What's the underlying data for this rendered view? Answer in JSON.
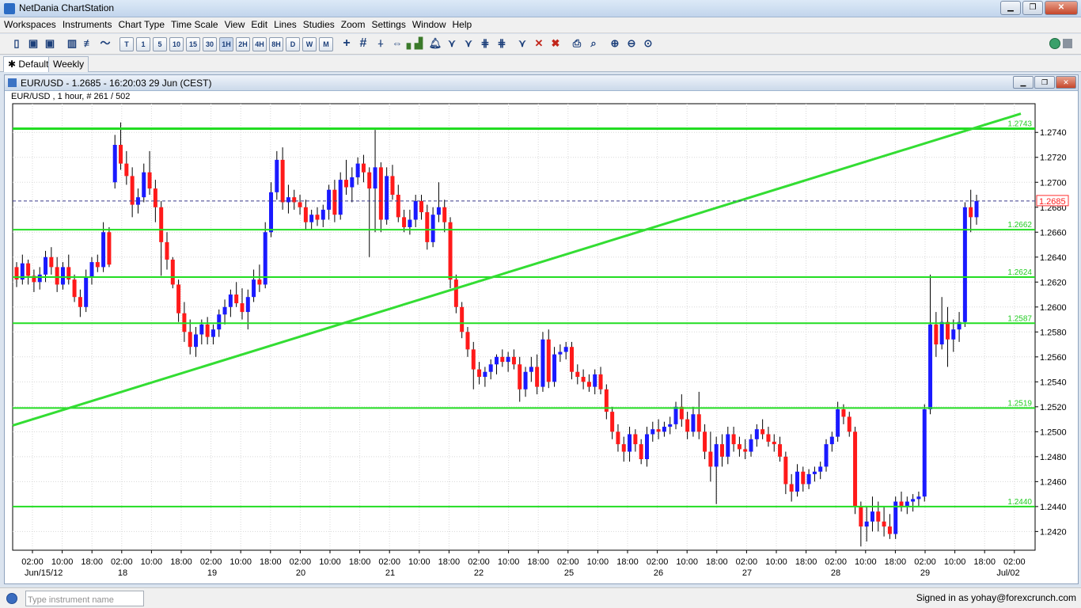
{
  "window": {
    "title": "NetDania ChartStation",
    "controls": [
      "minimize",
      "restore",
      "close"
    ]
  },
  "menu": [
    "Workspaces",
    "Instruments",
    "Chart Type",
    "Time Scale",
    "View",
    "Edit",
    "Lines",
    "Studies",
    "Zoom",
    "Settings",
    "Window",
    "Help"
  ],
  "toolbar": {
    "timeframes": [
      "T",
      "1",
      "5",
      "10",
      "15",
      "30",
      "1H",
      "2H",
      "4H",
      "8H",
      "D",
      "W",
      "M"
    ],
    "selected_timeframe": "1H"
  },
  "tabs": [
    {
      "label": "Default",
      "active": true
    },
    {
      "label": "Weekly",
      "active": false
    }
  ],
  "chart_window": {
    "title": "EUR/USD - 1.2685 - 16:20:03  29 Jun (CEST)",
    "info": "EUR/USD , 1 hour, # 261 / 502"
  },
  "chart_data": {
    "type": "candlestick",
    "symbol": "EUR/USD",
    "interval": "1 hour",
    "last_price": "1.2685",
    "ylim": [
      1.2405,
      1.2763
    ],
    "y_ticks": [
      "1.2420",
      "1.2440",
      "1.2460",
      "1.2480",
      "1.2500",
      "1.2520",
      "1.2540",
      "1.2560",
      "1.2580",
      "1.2600",
      "1.2620",
      "1.2640",
      "1.2660",
      "1.2680",
      "1.2700",
      "1.2720",
      "1.2740"
    ],
    "x_time_labels": [
      "02:00",
      "10:00",
      "18:00",
      "02:00",
      "10:00",
      "18:00",
      "02:00",
      "10:00",
      "18:00",
      "02:00",
      "10:00",
      "18:00",
      "02:00",
      "10:00",
      "18:00",
      "02:00",
      "10:00",
      "18:00",
      "02:00",
      "10:00",
      "18:00",
      "02:00",
      "10:00",
      "18:00",
      "02:00",
      "10:00",
      "18:00",
      "02:00",
      "10:00",
      "18:00",
      "02:00",
      "10:00",
      "18:00",
      "02:00"
    ],
    "x_date_labels": [
      "Jun/15/12",
      "18",
      "19",
      "20",
      "21",
      "22",
      "25",
      "26",
      "27",
      "28",
      "29",
      "Jul/02"
    ],
    "horizontal_lines": [
      1.2743,
      1.2662,
      1.2624,
      1.2587,
      1.2519,
      1.244
    ],
    "horizontal_line_labels": [
      "1.2743",
      "1.2662",
      "1.2624",
      "1.2587",
      "1.2519",
      "1.2440"
    ],
    "trendline": {
      "start": 1.2505,
      "end": 1.2755
    },
    "current_price_label": "1.2685",
    "candles": [
      {
        "o": 1.2632,
        "h": 1.2636,
        "l": 1.2616,
        "c": 1.2622
      },
      {
        "o": 1.2622,
        "h": 1.2642,
        "l": 1.2618,
        "c": 1.2635
      },
      {
        "o": 1.2635,
        "h": 1.2638,
        "l": 1.2618,
        "c": 1.2625
      },
      {
        "o": 1.2625,
        "h": 1.263,
        "l": 1.2612,
        "c": 1.262
      },
      {
        "o": 1.262,
        "h": 1.2632,
        "l": 1.2614,
        "c": 1.2626
      },
      {
        "o": 1.2626,
        "h": 1.2645,
        "l": 1.262,
        "c": 1.264
      },
      {
        "o": 1.264,
        "h": 1.2648,
        "l": 1.2626,
        "c": 1.2632
      },
      {
        "o": 1.2632,
        "h": 1.264,
        "l": 1.2612,
        "c": 1.2618
      },
      {
        "o": 1.2618,
        "h": 1.2636,
        "l": 1.2614,
        "c": 1.2632
      },
      {
        "o": 1.2632,
        "h": 1.2642,
        "l": 1.2618,
        "c": 1.2622
      },
      {
        "o": 1.2622,
        "h": 1.2626,
        "l": 1.2604,
        "c": 1.2608
      },
      {
        "o": 1.2608,
        "h": 1.2614,
        "l": 1.2592,
        "c": 1.26
      },
      {
        "o": 1.26,
        "h": 1.263,
        "l": 1.2596,
        "c": 1.2624
      },
      {
        "o": 1.2624,
        "h": 1.264,
        "l": 1.2618,
        "c": 1.2636
      },
      {
        "o": 1.2636,
        "h": 1.2642,
        "l": 1.2628,
        "c": 1.2632
      },
      {
        "o": 1.2632,
        "h": 1.2668,
        "l": 1.2628,
        "c": 1.266
      },
      {
        "o": 1.266,
        "h": 1.2664,
        "l": 1.2632,
        "c": 1.2634
      },
      {
        "o": 1.27,
        "h": 1.2738,
        "l": 1.2695,
        "c": 1.273
      },
      {
        "o": 1.273,
        "h": 1.2748,
        "l": 1.271,
        "c": 1.2715
      },
      {
        "o": 1.2715,
        "h": 1.2725,
        "l": 1.2698,
        "c": 1.2705
      },
      {
        "o": 1.2705,
        "h": 1.2712,
        "l": 1.2672,
        "c": 1.2682
      },
      {
        "o": 1.2682,
        "h": 1.2695,
        "l": 1.2675,
        "c": 1.2688
      },
      {
        "o": 1.2688,
        "h": 1.2715,
        "l": 1.2684,
        "c": 1.2708
      },
      {
        "o": 1.2708,
        "h": 1.2725,
        "l": 1.269,
        "c": 1.2695
      },
      {
        "o": 1.2695,
        "h": 1.2702,
        "l": 1.2668,
        "c": 1.268
      },
      {
        "o": 1.268,
        "h": 1.2685,
        "l": 1.2625,
        "c": 1.2652
      },
      {
        "o": 1.2652,
        "h": 1.266,
        "l": 1.263,
        "c": 1.2638
      },
      {
        "o": 1.2638,
        "h": 1.264,
        "l": 1.2615,
        "c": 1.2618
      },
      {
        "o": 1.2618,
        "h": 1.2622,
        "l": 1.2588,
        "c": 1.2595
      },
      {
        "o": 1.2595,
        "h": 1.2604,
        "l": 1.2572,
        "c": 1.258
      },
      {
        "o": 1.258,
        "h": 1.259,
        "l": 1.2562,
        "c": 1.2568
      },
      {
        "o": 1.2568,
        "h": 1.2584,
        "l": 1.256,
        "c": 1.2578
      },
      {
        "o": 1.2578,
        "h": 1.259,
        "l": 1.257,
        "c": 1.2586
      },
      {
        "o": 1.2586,
        "h": 1.2592,
        "l": 1.257,
        "c": 1.2576
      },
      {
        "o": 1.2576,
        "h": 1.2586,
        "l": 1.257,
        "c": 1.2582
      },
      {
        "o": 1.2582,
        "h": 1.2598,
        "l": 1.2576,
        "c": 1.2594
      },
      {
        "o": 1.2594,
        "h": 1.2606,
        "l": 1.2586,
        "c": 1.26
      },
      {
        "o": 1.26,
        "h": 1.2614,
        "l": 1.2592,
        "c": 1.261
      },
      {
        "o": 1.261,
        "h": 1.262,
        "l": 1.26,
        "c": 1.2603
      },
      {
        "o": 1.2603,
        "h": 1.2615,
        "l": 1.259,
        "c": 1.2596
      },
      {
        "o": 1.2596,
        "h": 1.2614,
        "l": 1.2582,
        "c": 1.2608
      },
      {
        "o": 1.2608,
        "h": 1.263,
        "l": 1.2604,
        "c": 1.2622
      },
      {
        "o": 1.2622,
        "h": 1.2634,
        "l": 1.2612,
        "c": 1.2618
      },
      {
        "o": 1.2618,
        "h": 1.2668,
        "l": 1.2615,
        "c": 1.266
      },
      {
        "o": 1.266,
        "h": 1.27,
        "l": 1.2656,
        "c": 1.2692
      },
      {
        "o": 1.2692,
        "h": 1.2725,
        "l": 1.2686,
        "c": 1.2718
      },
      {
        "o": 1.2718,
        "h": 1.2728,
        "l": 1.2678,
        "c": 1.2684
      },
      {
        "o": 1.2684,
        "h": 1.2698,
        "l": 1.2675,
        "c": 1.2688
      },
      {
        "o": 1.2688,
        "h": 1.2694,
        "l": 1.2678,
        "c": 1.2684
      },
      {
        "o": 1.2684,
        "h": 1.269,
        "l": 1.2674,
        "c": 1.268
      },
      {
        "o": 1.268,
        "h": 1.2686,
        "l": 1.2662,
        "c": 1.2668
      },
      {
        "o": 1.2668,
        "h": 1.2678,
        "l": 1.2662,
        "c": 1.2674
      },
      {
        "o": 1.2674,
        "h": 1.268,
        "l": 1.2665,
        "c": 1.267
      },
      {
        "o": 1.267,
        "h": 1.2682,
        "l": 1.2664,
        "c": 1.2678
      },
      {
        "o": 1.2678,
        "h": 1.2698,
        "l": 1.267,
        "c": 1.2694
      },
      {
        "o": 1.2694,
        "h": 1.2702,
        "l": 1.2668,
        "c": 1.2674
      },
      {
        "o": 1.2674,
        "h": 1.2708,
        "l": 1.267,
        "c": 1.2702
      },
      {
        "o": 1.2702,
        "h": 1.2718,
        "l": 1.269,
        "c": 1.2696
      },
      {
        "o": 1.2696,
        "h": 1.2712,
        "l": 1.2684,
        "c": 1.2704
      },
      {
        "o": 1.2704,
        "h": 1.272,
        "l": 1.2698,
        "c": 1.2715
      },
      {
        "o": 1.2715,
        "h": 1.2722,
        "l": 1.27,
        "c": 1.2708
      },
      {
        "o": 1.2708,
        "h": 1.2712,
        "l": 1.264,
        "c": 1.2695
      },
      {
        "o": 1.2695,
        "h": 1.2742,
        "l": 1.266,
        "c": 1.2712
      },
      {
        "o": 1.2712,
        "h": 1.2716,
        "l": 1.266,
        "c": 1.267
      },
      {
        "o": 1.267,
        "h": 1.2712,
        "l": 1.2666,
        "c": 1.2705
      },
      {
        "o": 1.2705,
        "h": 1.2714,
        "l": 1.2686,
        "c": 1.269
      },
      {
        "o": 1.269,
        "h": 1.2698,
        "l": 1.2668,
        "c": 1.2672
      },
      {
        "o": 1.2672,
        "h": 1.2678,
        "l": 1.266,
        "c": 1.2664
      },
      {
        "o": 1.2664,
        "h": 1.2678,
        "l": 1.2658,
        "c": 1.267
      },
      {
        "o": 1.267,
        "h": 1.269,
        "l": 1.2664,
        "c": 1.2685
      },
      {
        "o": 1.2685,
        "h": 1.269,
        "l": 1.267,
        "c": 1.2676
      },
      {
        "o": 1.2676,
        "h": 1.2682,
        "l": 1.2646,
        "c": 1.2652
      },
      {
        "o": 1.2652,
        "h": 1.268,
        "l": 1.2648,
        "c": 1.2674
      },
      {
        "o": 1.2674,
        "h": 1.27,
        "l": 1.2668,
        "c": 1.268
      },
      {
        "o": 1.268,
        "h": 1.2686,
        "l": 1.266,
        "c": 1.2668
      },
      {
        "o": 1.2668,
        "h": 1.2672,
        "l": 1.2615,
        "c": 1.2622
      },
      {
        "o": 1.2622,
        "h": 1.2626,
        "l": 1.2595,
        "c": 1.26
      },
      {
        "o": 1.26,
        "h": 1.2604,
        "l": 1.2575,
        "c": 1.258
      },
      {
        "o": 1.258,
        "h": 1.2584,
        "l": 1.256,
        "c": 1.2566
      },
      {
        "o": 1.2566,
        "h": 1.2572,
        "l": 1.2534,
        "c": 1.255
      },
      {
        "o": 1.255,
        "h": 1.2556,
        "l": 1.2538,
        "c": 1.2544
      },
      {
        "o": 1.2544,
        "h": 1.2552,
        "l": 1.2536,
        "c": 1.2548
      },
      {
        "o": 1.2548,
        "h": 1.2558,
        "l": 1.2542,
        "c": 1.2554
      },
      {
        "o": 1.2554,
        "h": 1.2562,
        "l": 1.2546,
        "c": 1.256
      },
      {
        "o": 1.256,
        "h": 1.2566,
        "l": 1.2552,
        "c": 1.2556
      },
      {
        "o": 1.2556,
        "h": 1.2564,
        "l": 1.2548,
        "c": 1.256
      },
      {
        "o": 1.256,
        "h": 1.2566,
        "l": 1.255,
        "c": 1.2554
      },
      {
        "o": 1.2554,
        "h": 1.256,
        "l": 1.2524,
        "c": 1.2534
      },
      {
        "o": 1.2534,
        "h": 1.2552,
        "l": 1.2528,
        "c": 1.2548
      },
      {
        "o": 1.2548,
        "h": 1.256,
        "l": 1.254,
        "c": 1.2552
      },
      {
        "o": 1.2552,
        "h": 1.2562,
        "l": 1.253,
        "c": 1.2536
      },
      {
        "o": 1.2536,
        "h": 1.258,
        "l": 1.2532,
        "c": 1.2574
      },
      {
        "o": 1.2574,
        "h": 1.2582,
        "l": 1.2535,
        "c": 1.254
      },
      {
        "o": 1.254,
        "h": 1.2568,
        "l": 1.2536,
        "c": 1.2562
      },
      {
        "o": 1.2562,
        "h": 1.257,
        "l": 1.2556,
        "c": 1.2564
      },
      {
        "o": 1.2564,
        "h": 1.2572,
        "l": 1.2558,
        "c": 1.2568
      },
      {
        "o": 1.2568,
        "h": 1.2572,
        "l": 1.2542,
        "c": 1.2548
      },
      {
        "o": 1.2548,
        "h": 1.2554,
        "l": 1.2538,
        "c": 1.2544
      },
      {
        "o": 1.2544,
        "h": 1.255,
        "l": 1.2534,
        "c": 1.254
      },
      {
        "o": 1.254,
        "h": 1.2546,
        "l": 1.2532,
        "c": 1.2536
      },
      {
        "o": 1.2536,
        "h": 1.255,
        "l": 1.253,
        "c": 1.2546
      },
      {
        "o": 1.2546,
        "h": 1.2552,
        "l": 1.253,
        "c": 1.2534
      },
      {
        "o": 1.2534,
        "h": 1.2538,
        "l": 1.251,
        "c": 1.2516
      },
      {
        "o": 1.2516,
        "h": 1.252,
        "l": 1.2494,
        "c": 1.25
      },
      {
        "o": 1.25,
        "h": 1.2506,
        "l": 1.2484,
        "c": 1.249
      },
      {
        "o": 1.249,
        "h": 1.2496,
        "l": 1.2476,
        "c": 1.2484
      },
      {
        "o": 1.2484,
        "h": 1.2504,
        "l": 1.2476,
        "c": 1.2498
      },
      {
        "o": 1.2498,
        "h": 1.2502,
        "l": 1.2484,
        "c": 1.249
      },
      {
        "o": 1.249,
        "h": 1.2494,
        "l": 1.2474,
        "c": 1.2478
      },
      {
        "o": 1.2478,
        "h": 1.2504,
        "l": 1.2472,
        "c": 1.2498
      },
      {
        "o": 1.2498,
        "h": 1.2508,
        "l": 1.2492,
        "c": 1.2502
      },
      {
        "o": 1.2502,
        "h": 1.251,
        "l": 1.2494,
        "c": 1.25
      },
      {
        "o": 1.25,
        "h": 1.2508,
        "l": 1.2496,
        "c": 1.2504
      },
      {
        "o": 1.2504,
        "h": 1.2512,
        "l": 1.2498,
        "c": 1.2506
      },
      {
        "o": 1.2506,
        "h": 1.2524,
        "l": 1.2502,
        "c": 1.252
      },
      {
        "o": 1.252,
        "h": 1.253,
        "l": 1.2504,
        "c": 1.251
      },
      {
        "o": 1.251,
        "h": 1.2516,
        "l": 1.2494,
        "c": 1.25
      },
      {
        "o": 1.25,
        "h": 1.252,
        "l": 1.2496,
        "c": 1.2514
      },
      {
        "o": 1.2514,
        "h": 1.2532,
        "l": 1.2494,
        "c": 1.25
      },
      {
        "o": 1.25,
        "h": 1.2506,
        "l": 1.2478,
        "c": 1.2484
      },
      {
        "o": 1.2484,
        "h": 1.25,
        "l": 1.246,
        "c": 1.2472
      },
      {
        "o": 1.2472,
        "h": 1.2496,
        "l": 1.2442,
        "c": 1.249
      },
      {
        "o": 1.249,
        "h": 1.2498,
        "l": 1.2472,
        "c": 1.248
      },
      {
        "o": 1.248,
        "h": 1.2504,
        "l": 1.2474,
        "c": 1.2498
      },
      {
        "o": 1.2498,
        "h": 1.2504,
        "l": 1.2484,
        "c": 1.249
      },
      {
        "o": 1.249,
        "h": 1.2496,
        "l": 1.248,
        "c": 1.2486
      },
      {
        "o": 1.2486,
        "h": 1.2494,
        "l": 1.2478,
        "c": 1.2484
      },
      {
        "o": 1.2484,
        "h": 1.2498,
        "l": 1.248,
        "c": 1.2494
      },
      {
        "o": 1.2494,
        "h": 1.2506,
        "l": 1.2488,
        "c": 1.2502
      },
      {
        "o": 1.2502,
        "h": 1.251,
        "l": 1.2494,
        "c": 1.2498
      },
      {
        "o": 1.2498,
        "h": 1.2504,
        "l": 1.2488,
        "c": 1.2492
      },
      {
        "o": 1.2492,
        "h": 1.2498,
        "l": 1.2484,
        "c": 1.249
      },
      {
        "o": 1.249,
        "h": 1.2496,
        "l": 1.2476,
        "c": 1.248
      },
      {
        "o": 1.248,
        "h": 1.2484,
        "l": 1.245,
        "c": 1.2458
      },
      {
        "o": 1.2458,
        "h": 1.2466,
        "l": 1.2444,
        "c": 1.2452
      },
      {
        "o": 1.2452,
        "h": 1.2474,
        "l": 1.2448,
        "c": 1.2468
      },
      {
        "o": 1.2468,
        "h": 1.2472,
        "l": 1.2452,
        "c": 1.2458
      },
      {
        "o": 1.2458,
        "h": 1.247,
        "l": 1.2454,
        "c": 1.2466
      },
      {
        "o": 1.2466,
        "h": 1.2472,
        "l": 1.246,
        "c": 1.2468
      },
      {
        "o": 1.2468,
        "h": 1.2476,
        "l": 1.2462,
        "c": 1.2472
      },
      {
        "o": 1.2472,
        "h": 1.2494,
        "l": 1.2468,
        "c": 1.249
      },
      {
        "o": 1.249,
        "h": 1.25,
        "l": 1.2484,
        "c": 1.2496
      },
      {
        "o": 1.2496,
        "h": 1.2524,
        "l": 1.2492,
        "c": 1.2518
      },
      {
        "o": 1.2518,
        "h": 1.2522,
        "l": 1.2506,
        "c": 1.2512
      },
      {
        "o": 1.2512,
        "h": 1.2516,
        "l": 1.2496,
        "c": 1.25
      },
      {
        "o": 1.25,
        "h": 1.2504,
        "l": 1.2434,
        "c": 1.244
      },
      {
        "o": 1.244,
        "h": 1.2444,
        "l": 1.2408,
        "c": 1.2424
      },
      {
        "o": 1.2424,
        "h": 1.244,
        "l": 1.2412,
        "c": 1.2428
      },
      {
        "o": 1.2428,
        "h": 1.2448,
        "l": 1.242,
        "c": 1.2436
      },
      {
        "o": 1.2436,
        "h": 1.2444,
        "l": 1.242,
        "c": 1.2428
      },
      {
        "o": 1.2428,
        "h": 1.244,
        "l": 1.2416,
        "c": 1.2424
      },
      {
        "o": 1.2424,
        "h": 1.2434,
        "l": 1.2414,
        "c": 1.2418
      },
      {
        "o": 1.2418,
        "h": 1.2448,
        "l": 1.2414,
        "c": 1.2444
      },
      {
        "o": 1.2444,
        "h": 1.2452,
        "l": 1.2436,
        "c": 1.244
      },
      {
        "o": 1.244,
        "h": 1.2448,
        "l": 1.2434,
        "c": 1.2444
      },
      {
        "o": 1.2444,
        "h": 1.245,
        "l": 1.2436,
        "c": 1.2446
      },
      {
        "o": 1.2446,
        "h": 1.2452,
        "l": 1.244,
        "c": 1.2448
      },
      {
        "o": 1.2448,
        "h": 1.2522,
        "l": 1.2444,
        "c": 1.2518
      },
      {
        "o": 1.2518,
        "h": 1.2626,
        "l": 1.2514,
        "c": 1.2586
      },
      {
        "o": 1.2586,
        "h": 1.2596,
        "l": 1.256,
        "c": 1.257
      },
      {
        "o": 1.257,
        "h": 1.2608,
        "l": 1.2566,
        "c": 1.2588
      },
      {
        "o": 1.2588,
        "h": 1.26,
        "l": 1.2552,
        "c": 1.2574
      },
      {
        "o": 1.2574,
        "h": 1.259,
        "l": 1.2564,
        "c": 1.2582
      },
      {
        "o": 1.2582,
        "h": 1.2596,
        "l": 1.2572,
        "c": 1.2588
      },
      {
        "o": 1.2588,
        "h": 1.2684,
        "l": 1.2584,
        "c": 1.268
      },
      {
        "o": 1.268,
        "h": 1.2694,
        "l": 1.266,
        "c": 1.2672
      },
      {
        "o": 1.2672,
        "h": 1.269,
        "l": 1.2666,
        "c": 1.2685
      }
    ]
  },
  "status": {
    "search_placeholder": "Type instrument name",
    "signed_in": "Signed in as yohay@forexcrunch.com"
  }
}
